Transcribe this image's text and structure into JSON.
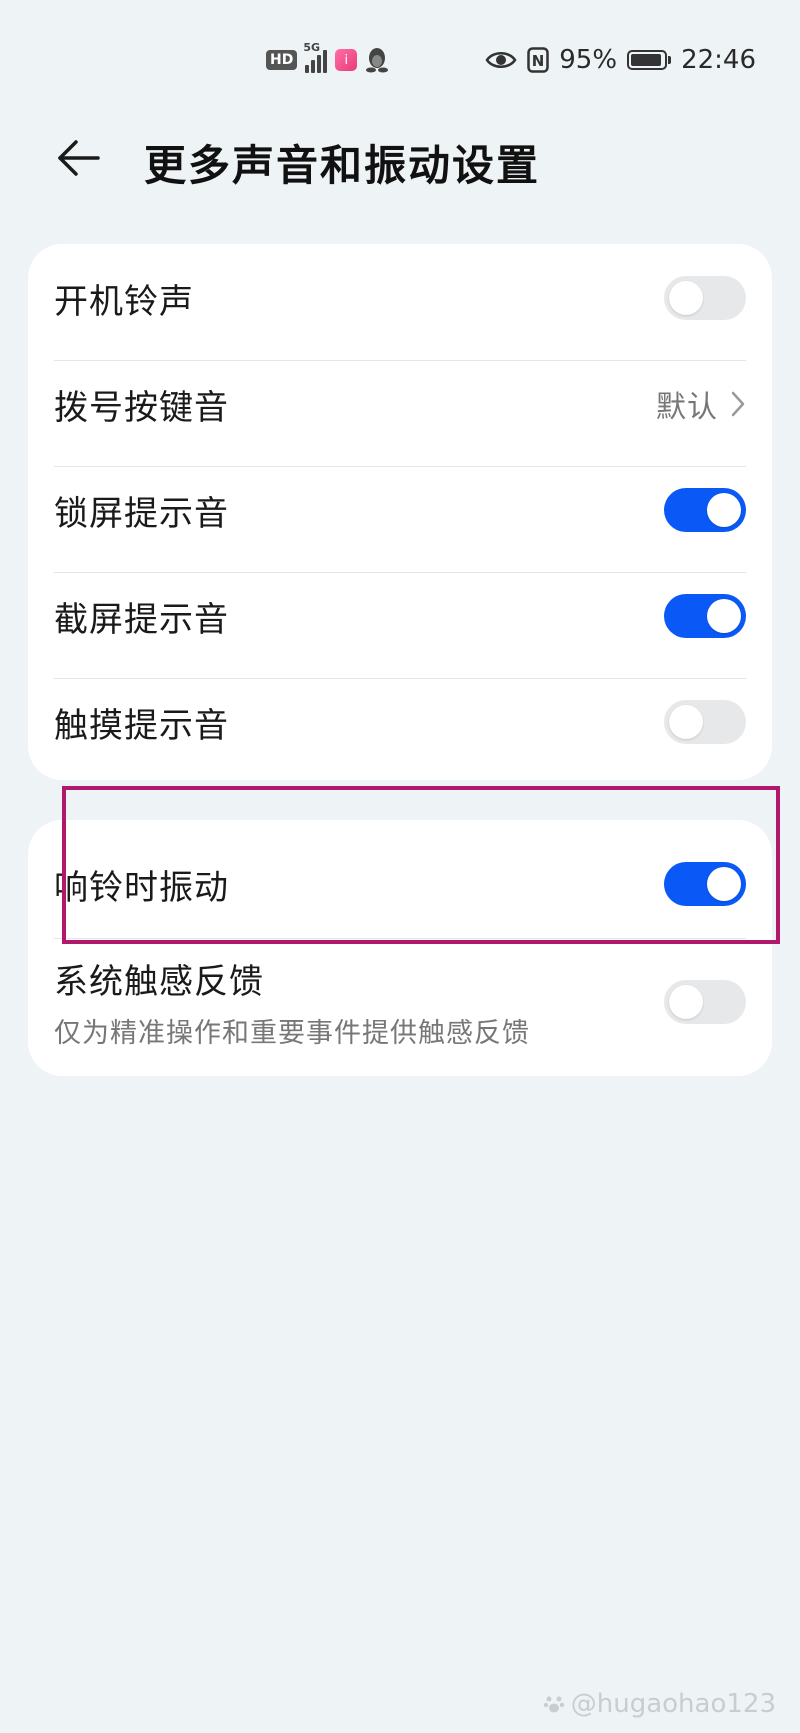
{
  "status_bar": {
    "hd_label": "HD",
    "network_label": "5G",
    "app_badge_label": "i",
    "nfc_label": "N",
    "battery_percent_label": "95%",
    "battery_level": 0.95,
    "time": "22:46",
    "icons": [
      "hd-icon",
      "signal-icon",
      "app-notification-icon",
      "qq-penguin-icon",
      "eye-comfort-icon",
      "nfc-icon",
      "battery-icon"
    ]
  },
  "header": {
    "back_icon": "arrow-left-icon",
    "title": "更多声音和振动设置"
  },
  "sound_settings": {
    "items": [
      {
        "label": "开机铃声",
        "type": "toggle",
        "on": false
      },
      {
        "label": "拨号按键音",
        "type": "link",
        "value": "默认"
      },
      {
        "label": "锁屏提示音",
        "type": "toggle",
        "on": true
      },
      {
        "label": "截屏提示音",
        "type": "toggle",
        "on": true
      },
      {
        "label": "触摸提示音",
        "type": "toggle",
        "on": false
      }
    ]
  },
  "vibration_settings": {
    "items": [
      {
        "label": "响铃时振动",
        "type": "toggle",
        "on": true
      },
      {
        "label": "系统触感反馈",
        "sublabel": "仅为精准操作和重要事件提供触感反馈",
        "type": "toggle",
        "on": false
      }
    ]
  },
  "watermark": {
    "text": "@hugaohao123"
  },
  "colors": {
    "background": "#eef3f5",
    "card": "#ffffff",
    "toggle_on": "#0a59f7",
    "toggle_off": "#e6e8ea",
    "highlight": "#b0196b"
  }
}
